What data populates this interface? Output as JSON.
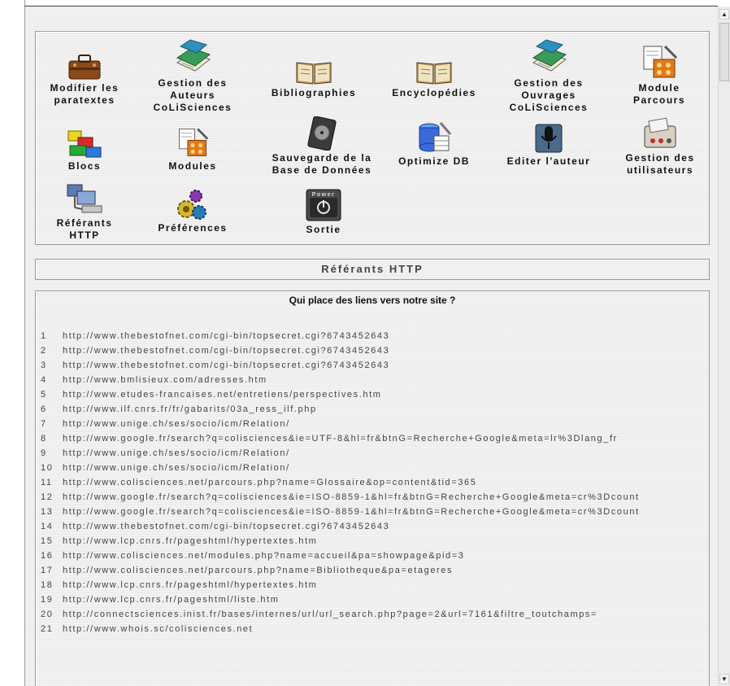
{
  "icons": [
    {
      "label": "Modifier les\nparatextes",
      "icon": "suitcase-icon"
    },
    {
      "label": "Gestion des\nAuteurs\nCoLiSciences",
      "icon": "book-icon"
    },
    {
      "label": "Bibliographies",
      "icon": "open-book-icon"
    },
    {
      "label": "Encyclopédies",
      "icon": "open-book-icon"
    },
    {
      "label": "Gestion des\nOuvrages\nCoLiSciences",
      "icon": "book-icon"
    },
    {
      "label": "Module\nParcours",
      "icon": "tools-icon"
    },
    {
      "label": "Blocs",
      "icon": "blocks-icon"
    },
    {
      "label": "Modules",
      "icon": "tools-icon"
    },
    {
      "label": "Sauvegarde de la\nBase de Données",
      "icon": "disk-icon"
    },
    {
      "label": "Optimize DB",
      "icon": "database-icon"
    },
    {
      "label": "Editer l'auteur",
      "icon": "microphone-icon"
    },
    {
      "label": "Gestion des\nutilisateurs",
      "icon": "card-reader-icon"
    },
    {
      "label": "Référants\nHTTP",
      "icon": "computers-icon"
    },
    {
      "label": "Préférences",
      "icon": "gears-icon"
    },
    {
      "label": "Sortie",
      "icon": "power-icon",
      "icon_text": "Power"
    }
  ],
  "section_title": "Référants HTTP",
  "list_heading": "Qui place des liens vers notre site ?",
  "referers": [
    {
      "n": "1",
      "url": "http://www.thebestofnet.com/cgi-bin/topsecret.cgi?6743452643"
    },
    {
      "n": "2",
      "url": "http://www.thebestofnet.com/cgi-bin/topsecret.cgi?6743452643"
    },
    {
      "n": "3",
      "url": "http://www.thebestofnet.com/cgi-bin/topsecret.cgi?6743452643"
    },
    {
      "n": "4",
      "url": "http://www.bmlisieux.com/adresses.htm"
    },
    {
      "n": "5",
      "url": "http://www.etudes-francaises.net/entretiens/perspectives.htm"
    },
    {
      "n": "6",
      "url": "http://www.ilf.cnrs.fr/fr/gabarits/03a_ress_ilf.php"
    },
    {
      "n": "7",
      "url": "http://www.unige.ch/ses/socio/icm/Relation/"
    },
    {
      "n": "8",
      "url": "http://www.google.fr/search?q=colisciences&ie=UTF-8&hl=fr&btnG=Recherche+Google&meta=lr%3Dlang_fr"
    },
    {
      "n": "9",
      "url": "http://www.unige.ch/ses/socio/icm/Relation/"
    },
    {
      "n": "10",
      "url": "http://www.unige.ch/ses/socio/icm/Relation/"
    },
    {
      "n": "11",
      "url": "http://www.colisciences.net/parcours.php?name=Glossaire&op=content&tid=365"
    },
    {
      "n": "12",
      "url": "http://www.google.fr/search?q=colisciences&ie=ISO-8859-1&hl=fr&btnG=Recherche+Google&meta=cr%3Dcount"
    },
    {
      "n": "13",
      "url": "http://www.google.fr/search?q=colisciences&ie=ISO-8859-1&hl=fr&btnG=Recherche+Google&meta=cr%3Dcount"
    },
    {
      "n": "14",
      "url": "http://www.thebestofnet.com/cgi-bin/topsecret.cgi?6743452643"
    },
    {
      "n": "15",
      "url": "http://www.lcp.cnrs.fr/pageshtml/hypertextes.htm"
    },
    {
      "n": "16",
      "url": "http://www.colisciences.net/modules.php?name=accueil&pa=showpage&pid=3"
    },
    {
      "n": "17",
      "url": "http://www.colisciences.net/parcours.php?name=Bibliotheque&pa=etageres"
    },
    {
      "n": "18",
      "url": "http://www.lcp.cnrs.fr/pageshtml/hypertextes.htm"
    },
    {
      "n": "19",
      "url": "http://www.lcp.cnrs.fr/pageshtml/liste.htm"
    },
    {
      "n": "20",
      "url": "http://connectsciences.inist.fr/bases/internes/url/url_search.php?page=2&url=7161&filtre_toutchamps="
    },
    {
      "n": "21",
      "url": "http://www.whois.sc/colisciences.net"
    }
  ]
}
